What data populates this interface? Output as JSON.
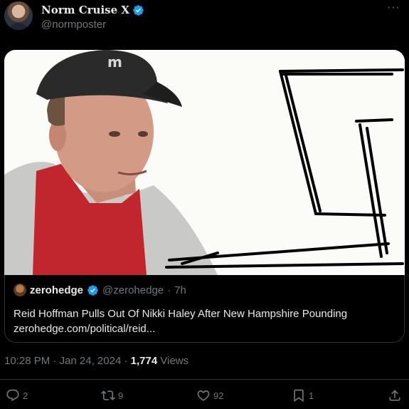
{
  "author": {
    "display_name": "Norm Cruise X",
    "handle": "@normposter"
  },
  "more_label": "···",
  "quote": {
    "display_name": "zerohedge",
    "handle": "@zerohedge",
    "separator": "·",
    "age": "7h",
    "text": "Reid Hoffman Pulls Out Of Nikki Haley After New Hampshire Pounding",
    "link": "zerohedge.com/political/reid..."
  },
  "meta": {
    "time": "10:28 PM",
    "separator": "·",
    "date": "Jan 24, 2024",
    "views_count": "1,774",
    "views_label": "Views"
  },
  "actions": {
    "replies": "2",
    "reposts": "9",
    "likes": "92",
    "bookmarks": "1"
  },
  "colors": {
    "background": "#000000",
    "text": "#e7e9ea",
    "muted": "#71767b",
    "verified": "#1d9bf0",
    "border": "#2f3336"
  }
}
